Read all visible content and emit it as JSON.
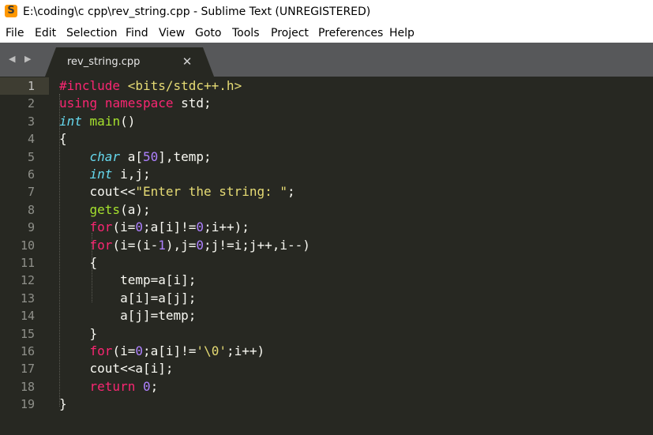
{
  "window": {
    "title": "E:\\coding\\c cpp\\rev_string.cpp - Sublime Text (UNREGISTERED)",
    "logo_glyph": "S"
  },
  "menu": [
    "File",
    "Edit",
    "Selection",
    "Find",
    "View",
    "Goto",
    "Tools",
    "Project",
    "Preferences",
    "Help"
  ],
  "tabs": {
    "nav_back": "◀",
    "nav_forward": "▶",
    "active": {
      "label": "rev_string.cpp",
      "close_glyph": "✕"
    }
  },
  "editor": {
    "active_line": 1,
    "line_numbers": [
      "1",
      "2",
      "3",
      "4",
      "5",
      "6",
      "7",
      "8",
      "9",
      "10",
      "11",
      "12",
      "13",
      "14",
      "15",
      "16",
      "17",
      "18",
      "19"
    ],
    "lines": [
      [
        {
          "t": "#include",
          "c": "k"
        },
        {
          "t": " ",
          "c": "p"
        },
        {
          "t": "<bits/stdc++.h>",
          "c": "s"
        }
      ],
      [
        {
          "t": "using",
          "c": "k"
        },
        {
          "t": " ",
          "c": "p"
        },
        {
          "t": "namespace",
          "c": "k"
        },
        {
          "t": " std;",
          "c": "p"
        }
      ],
      [
        {
          "t": "int",
          "c": "t"
        },
        {
          "t": " ",
          "c": "p"
        },
        {
          "t": "main",
          "c": "f"
        },
        {
          "t": "()",
          "c": "p"
        }
      ],
      [
        {
          "t": "{",
          "c": "p"
        }
      ],
      [
        {
          "t": "    ",
          "c": "p"
        },
        {
          "t": "char",
          "c": "t"
        },
        {
          "t": " a[",
          "c": "p"
        },
        {
          "t": "50",
          "c": "n"
        },
        {
          "t": "],temp;",
          "c": "p"
        }
      ],
      [
        {
          "t": "    ",
          "c": "p"
        },
        {
          "t": "int",
          "c": "t"
        },
        {
          "t": " i,j;",
          "c": "p"
        }
      ],
      [
        {
          "t": "    cout<<",
          "c": "p"
        },
        {
          "t": "\"Enter the string: \"",
          "c": "s"
        },
        {
          "t": ";",
          "c": "p"
        }
      ],
      [
        {
          "t": "    ",
          "c": "p"
        },
        {
          "t": "gets",
          "c": "f"
        },
        {
          "t": "(a);",
          "c": "p"
        }
      ],
      [
        {
          "t": "    ",
          "c": "p"
        },
        {
          "t": "for",
          "c": "k"
        },
        {
          "t": "(i=",
          "c": "p"
        },
        {
          "t": "0",
          "c": "n"
        },
        {
          "t": ";a[i]!=",
          "c": "p"
        },
        {
          "t": "0",
          "c": "n"
        },
        {
          "t": ";i++);",
          "c": "p"
        }
      ],
      [
        {
          "t": "    ",
          "c": "p"
        },
        {
          "t": "for",
          "c": "k"
        },
        {
          "t": "(i=(i-",
          "c": "p"
        },
        {
          "t": "1",
          "c": "n"
        },
        {
          "t": "),j=",
          "c": "p"
        },
        {
          "t": "0",
          "c": "n"
        },
        {
          "t": ";j!=i;j++,i--)",
          "c": "p"
        }
      ],
      [
        {
          "t": "    {",
          "c": "p"
        }
      ],
      [
        {
          "t": "        temp=a[i];",
          "c": "p"
        }
      ],
      [
        {
          "t": "        a[i]=a[j];",
          "c": "p"
        }
      ],
      [
        {
          "t": "        a[j]=temp;",
          "c": "p"
        }
      ],
      [
        {
          "t": "    }",
          "c": "p"
        }
      ],
      [
        {
          "t": "    ",
          "c": "p"
        },
        {
          "t": "for",
          "c": "k"
        },
        {
          "t": "(i=",
          "c": "p"
        },
        {
          "t": "0",
          "c": "n"
        },
        {
          "t": ";a[i]!=",
          "c": "p"
        },
        {
          "t": "'\\0'",
          "c": "s"
        },
        {
          "t": ";i++)",
          "c": "p"
        }
      ],
      [
        {
          "t": "    cout<<a[i];",
          "c": "p"
        }
      ],
      [
        {
          "t": "    ",
          "c": "p"
        },
        {
          "t": "return",
          "c": "k"
        },
        {
          "t": " ",
          "c": "p"
        },
        {
          "t": "0",
          "c": "n"
        },
        {
          "t": ";",
          "c": "p"
        }
      ],
      [
        {
          "t": "}",
          "c": "p"
        }
      ]
    ]
  },
  "colors": {
    "background": "#272822",
    "keyword": "#f92672",
    "type": "#66d9ef",
    "function": "#a6e22e",
    "string": "#e6db74",
    "number": "#ae81ff",
    "plain": "#f8f8f2",
    "line_number": "#8f908a",
    "tab_bar": "#57585a",
    "active_tab": "#272822",
    "logo": "#ff9800"
  }
}
